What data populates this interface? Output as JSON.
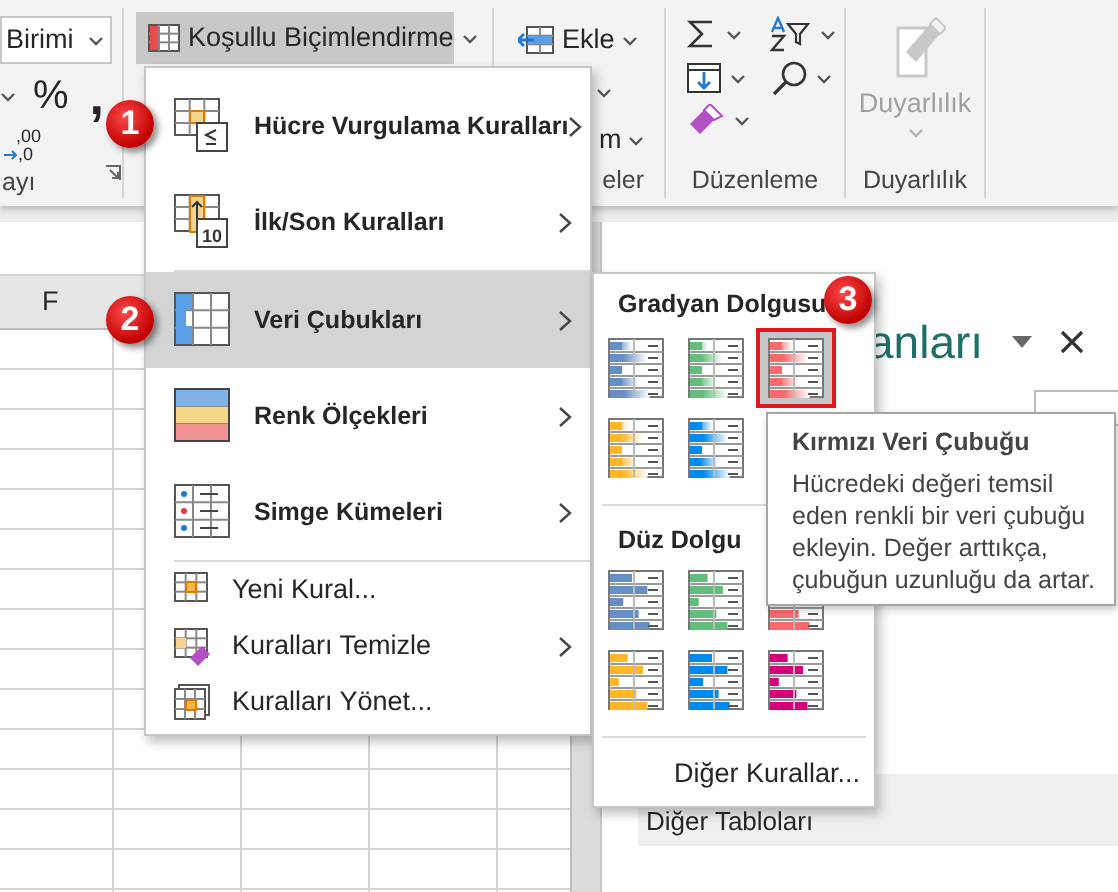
{
  "ribbon": {
    "number_format": "Birimi",
    "number_buttons": [
      "%",
      ","
    ],
    "decimal_button": {
      "top": ",00",
      "bottom": ",0"
    },
    "number_group": "ayı",
    "conditional_formatting": {
      "label": "Koşullu Biçimlendirme",
      "pressed": true
    },
    "insert": "Ekle",
    "format_partial": "m",
    "cells_group": "eler",
    "editing_group": "Düzenleme",
    "sensitivity_button": {
      "label": "Duyarlılık",
      "disabled": true
    },
    "sensitivity_group": "Duyarlılık"
  },
  "sheet": {
    "column_header": "F"
  },
  "side_pane": {
    "title_partial": "anları",
    "more_text": "Diğer Tabloları"
  },
  "menu": {
    "items": [
      {
        "kind": "large",
        "label": "Hücre Vurgulama Kuralları",
        "submenu": true,
        "selected": false
      },
      {
        "kind": "large",
        "label": "İlk/Son Kuralları",
        "submenu": true,
        "selected": false,
        "icon_text": "10"
      },
      {
        "kind": "large",
        "label": "Veri Çubukları",
        "submenu": true,
        "selected": true
      },
      {
        "kind": "large",
        "label": "Renk Ölçekleri",
        "submenu": true,
        "selected": false
      },
      {
        "kind": "large",
        "label": "Simge Kümeleri",
        "submenu": true,
        "selected": false
      },
      {
        "kind": "small",
        "label": "Yeni Kural...",
        "submenu": false,
        "selected": false
      },
      {
        "kind": "small",
        "label": "Kuralları Temizle",
        "submenu": true,
        "selected": false
      },
      {
        "kind": "small",
        "label": "Kuralları Yönet...",
        "submenu": false,
        "selected": false
      }
    ]
  },
  "submenu": {
    "sections": [
      {
        "title": "Gradyan Dolgusu",
        "kind": "gradient",
        "bars": [
          {
            "color": "#638ec6",
            "selected": false
          },
          {
            "color": "#63be7b",
            "selected": false
          },
          {
            "color": "#f8696b",
            "selected": true
          },
          {
            "color": "#ffb628",
            "selected": false
          },
          {
            "color": "#008aef",
            "selected": false
          }
        ]
      },
      {
        "title": "Düz Dolgu",
        "kind": "solid",
        "bars": [
          {
            "color": "#638ec6",
            "selected": false
          },
          {
            "color": "#63be7b",
            "selected": false
          },
          {
            "color": "#f8696b",
            "selected": false
          },
          {
            "color": "#ffb628",
            "selected": false
          },
          {
            "color": "#008aef",
            "selected": false
          },
          {
            "color": "#d6007b",
            "selected": false
          }
        ]
      }
    ],
    "footer": "Diğer Kurallar..."
  },
  "tooltip": {
    "title": "Kırmızı Veri Çubuğu",
    "body": "Hücredeki değeri temsil eden renkli bir veri çubuğu ekleyin. Değer arttıkça, çubuğun uzunluğu da artar."
  },
  "callouts": [
    "1",
    "2",
    "3"
  ]
}
